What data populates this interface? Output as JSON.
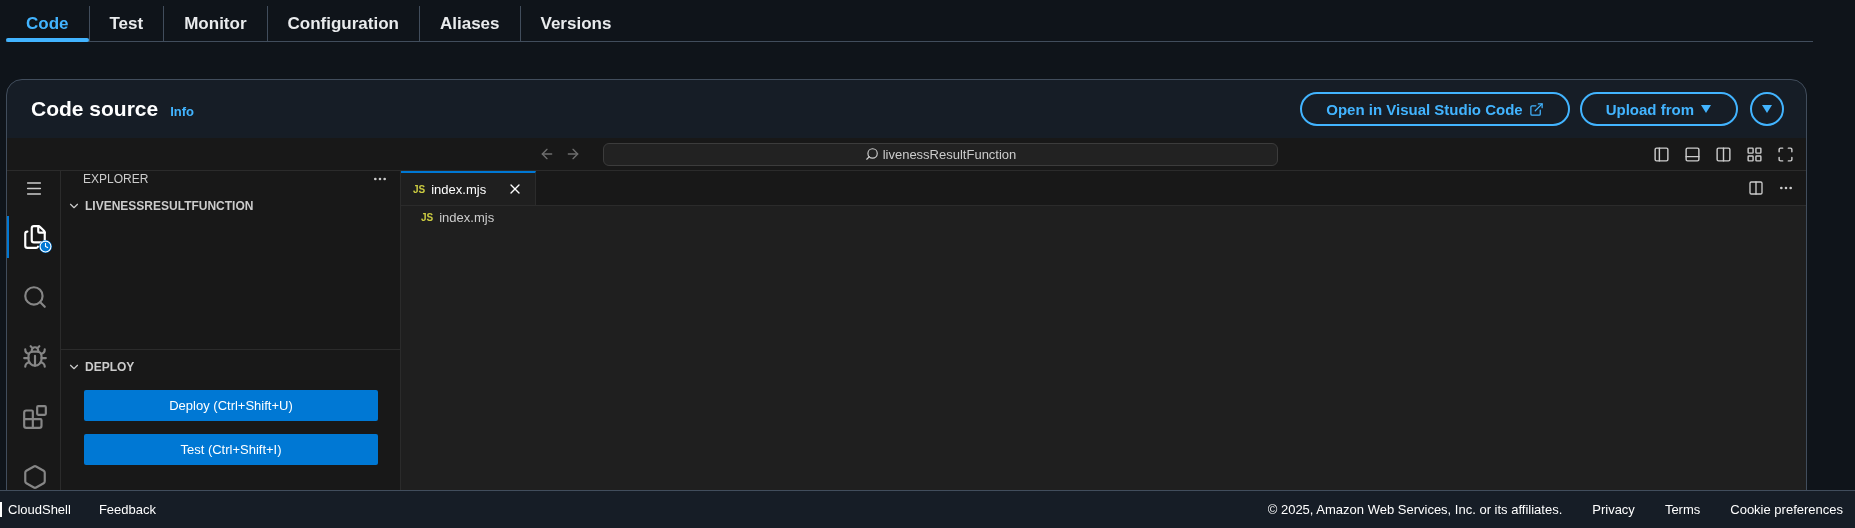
{
  "tabs": [
    {
      "label": "Code",
      "selected": true
    },
    {
      "label": "Test",
      "selected": false
    },
    {
      "label": "Monitor",
      "selected": false
    },
    {
      "label": "Configuration",
      "selected": false
    },
    {
      "label": "Aliases",
      "selected": false
    },
    {
      "label": "Versions",
      "selected": false
    }
  ],
  "header": {
    "title": "Code source",
    "info": "Info",
    "buttons": [
      {
        "label": "Open in Visual Studio Code",
        "kind": "external"
      },
      {
        "label": "Upload from",
        "kind": "dropdown"
      }
    ]
  },
  "editor": {
    "command_center": "livenessResultFunction",
    "activity": [
      {
        "kind": "explorer",
        "selected": true
      },
      {
        "kind": "search",
        "selected": false
      },
      {
        "kind": "run",
        "selected": false
      },
      {
        "kind": "extensions",
        "selected": false
      },
      {
        "kind": "hexagon",
        "selected": false
      }
    ],
    "sidebar": {
      "title": "EXPLORER",
      "folder": {
        "name": "LIVENESSRESULTFUNCTION",
        "expanded": true
      },
      "deploy": {
        "title": "DEPLOY",
        "expanded": true,
        "buttons": [
          "Deploy (Ctrl+Shift+U)",
          "Test (Ctrl+Shift+I)"
        ]
      }
    },
    "tabs": [
      {
        "badge": "JS",
        "label": "index.mjs",
        "selected": true
      }
    ],
    "files": [
      {
        "badge": "JS",
        "name": "index.mjs"
      }
    ]
  },
  "footer": {
    "left": [
      "CloudShell",
      "Feedback"
    ],
    "copyright": "© 2025, Amazon Web Services, Inc. or its affiliates.",
    "links": [
      "Privacy",
      "Terms",
      "Cookie preferences"
    ]
  }
}
